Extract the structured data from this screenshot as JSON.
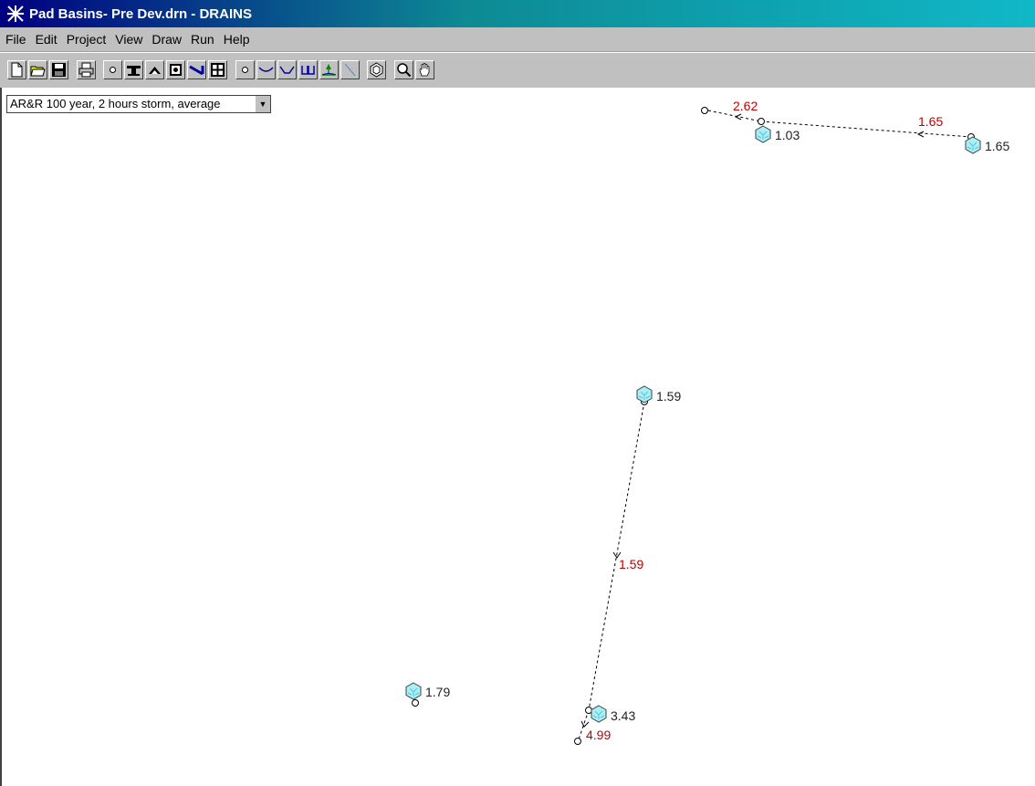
{
  "window": {
    "title": "Pad Basins- Pre Dev.drn - DRAINS"
  },
  "menu": [
    "File",
    "Edit",
    "Project",
    "View",
    "Draw",
    "Run",
    "Help"
  ],
  "toolbar": {
    "buttons": [
      "new-file-icon",
      "open-folder-icon",
      "save-icon",
      "print-icon",
      "node-icon",
      "pit-icon",
      "headwall-icon",
      "detention-basin-icon",
      "pipe-icon",
      "grid-icon",
      "junction-icon",
      "channel-icon",
      "overflow-channel-icon",
      "weir-icon",
      "outlet-icon",
      "line-icon",
      "catchment-icon",
      "zoom-icon",
      "pan-hand-icon"
    ]
  },
  "storm_select": {
    "value": "AR&R 100 year, 2 hours storm, average"
  },
  "catchments": [
    {
      "id": "c1",
      "label": "1.03"
    },
    {
      "id": "c2",
      "label": "1.65"
    },
    {
      "id": "c3",
      "label": "1.59"
    },
    {
      "id": "c4",
      "label": "1.79"
    },
    {
      "id": "c5",
      "label": "3.43"
    }
  ],
  "links": [
    {
      "id": "l1",
      "label": "2.62"
    },
    {
      "id": "l2",
      "label": "1.65"
    },
    {
      "id": "l3",
      "label": "1.59"
    },
    {
      "id": "l4",
      "label": "4.99"
    }
  ],
  "colors": {
    "catchment_fill": "#a8f0f8",
    "flow_label": "#c00000",
    "title_gradient_start": "#000080",
    "title_gradient_end": "#10b8c8"
  }
}
